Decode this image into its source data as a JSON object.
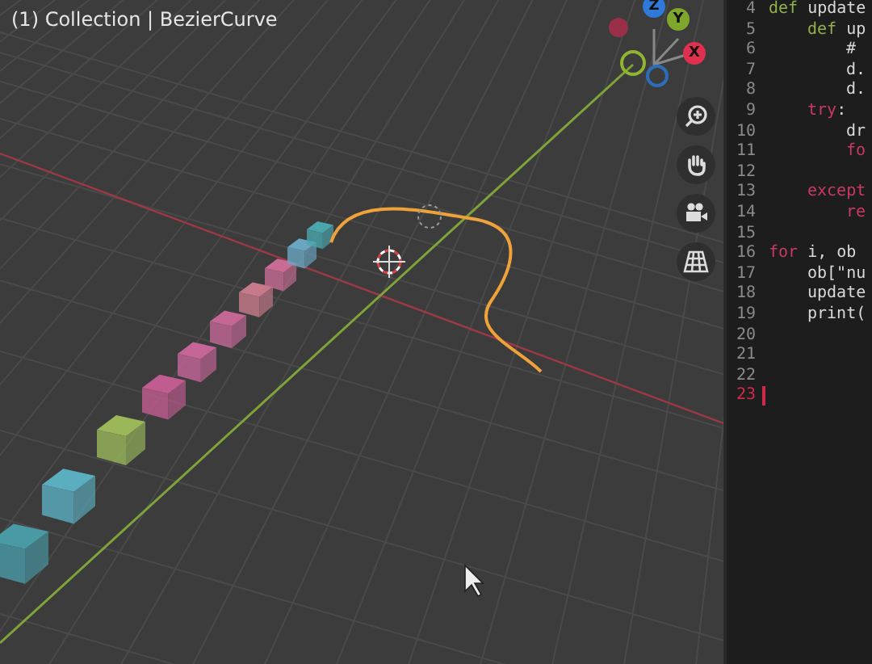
{
  "viewport": {
    "header": "(1) Collection | BezierCurve",
    "gizmo": [
      {
        "label": "Z",
        "color": "#2e79d9"
      },
      {
        "label": "Y",
        "color": "#7ea72c"
      },
      {
        "label": "X",
        "color": "#e0304f"
      }
    ],
    "cubes": [
      {
        "color": "#4a9aa6"
      },
      {
        "color": "#5aaec0"
      },
      {
        "color": "#9ab85a"
      },
      {
        "color": "#c05c90"
      },
      {
        "color": "#c56598"
      },
      {
        "color": "#c46795"
      },
      {
        "color": "#c77b8a"
      },
      {
        "color": "#c86c94"
      },
      {
        "color": "#6aa6c2"
      },
      {
        "color": "#4aa6ac"
      }
    ]
  },
  "editor": {
    "lines": [
      {
        "number": "4",
        "current": false,
        "tokens": [
          {
            "text": "def",
            "kind": "def"
          },
          {
            "text": "update",
            "kind": "plain"
          }
        ],
        "children": [
          {
            "number": "5",
            "current": false,
            "tokens": [
              {
                "text": "def",
                "kind": "def"
              },
              {
                "text": "up",
                "kind": "plain"
              }
            ],
            "children": [
              {
                "number": "6",
                "current": false,
                "tokens": [
                  {
                    "text": "#",
                    "kind": "plain"
                  }
                ]
              },
              {
                "number": "7",
                "current": false,
                "tokens": [
                  {
                    "text": "d.",
                    "kind": "plain"
                  }
                ]
              },
              {
                "number": "8",
                "current": false,
                "tokens": [
                  {
                    "text": "d.",
                    "kind": "plain"
                  }
                ]
              }
            ]
          },
          {
            "number": "9",
            "current": false,
            "tokens": [
              {
                "text": "try",
                "kind": "keyword"
              },
              {
                "text": ":",
                "kind": "punct"
              }
            ],
            "children": [
              {
                "number": "10",
                "current": false,
                "tokens": [
                  {
                    "text": "dr",
                    "kind": "plain"
                  }
                ]
              },
              {
                "number": "11",
                "current": false,
                "tokens": [
                  {
                    "text": "fo",
                    "kind": "keyword"
                  }
                ]
              },
              {
                "number": "12",
                "current": false
              }
            ]
          },
          {
            "number": "13",
            "current": false,
            "tokens": [
              {
                "text": "except",
                "kind": "keyword"
              }
            ],
            "children": [
              {
                "number": "14",
                "current": false,
                "tokens": [
                  {
                    "text": "re",
                    "kind": "keyword"
                  }
                ]
              }
            ]
          }
        ]
      },
      {
        "number": "15",
        "current": false
      },
      {
        "number": "16",
        "current": false,
        "tokens": [
          {
            "text": "for",
            "kind": "keyword"
          },
          {
            "text": "i, ob",
            "kind": "plain"
          }
        ],
        "children": [
          {
            "number": "17",
            "current": false,
            "tokens": [
              {
                "text": "ob[\"nu",
                "kind": "plain"
              }
            ]
          },
          {
            "number": "18",
            "current": false,
            "tokens": [
              {
                "text": "update",
                "kind": "plain"
              }
            ]
          },
          {
            "number": "19",
            "current": false,
            "tokens": [
              {
                "text": "print(",
                "kind": "plain"
              }
            ]
          }
        ]
      },
      {
        "number": "20",
        "current": false
      },
      {
        "number": "21",
        "current": false
      },
      {
        "number": "22",
        "current": false
      },
      {
        "number": "23",
        "current": true
      }
    ]
  }
}
